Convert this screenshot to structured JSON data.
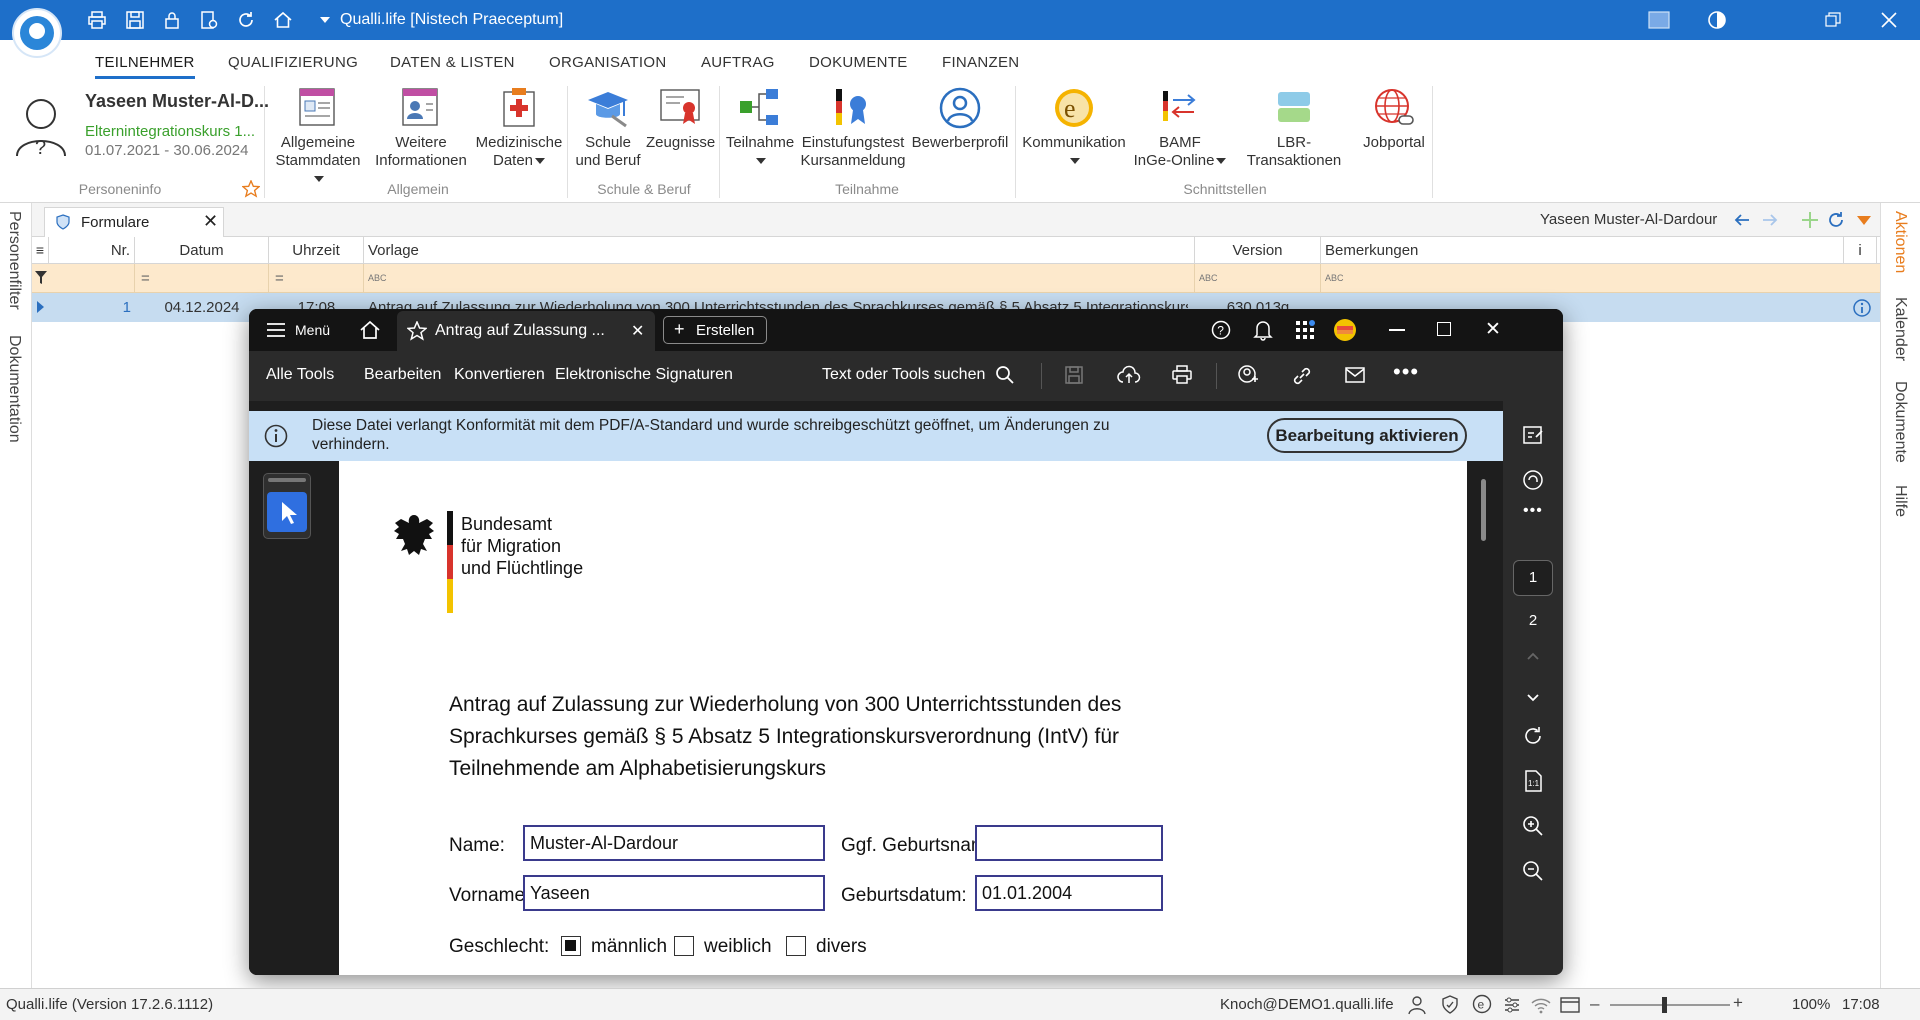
{
  "app": {
    "title": "Qualli.life [Nistech Praeceptum]",
    "status_version": "Qualli.life (Version 17.2.6.1112)",
    "status_user": "Knoch@DEMO1.qualli.life",
    "status_zoom": "100%",
    "status_time": "17:08"
  },
  "ribbon": {
    "tabs": [
      "TEILNEHMER",
      "QUALIFIZIERUNG",
      "DATEN & LISTEN",
      "ORGANISATION",
      "AUFTRAG",
      "DOKUMENTE",
      "FINANZEN"
    ],
    "person": {
      "name": "Yaseen Muster-Al-D...",
      "course": "Elternintegrationskurs 1...",
      "dates": "01.07.2021 - 30.06.2024"
    },
    "groups": {
      "personeninfo": "Personeninfo",
      "allgemein": "Allgemein",
      "schule": "Schule & Beruf",
      "teilnahme": "Teilnahme",
      "schnittstellen": "Schnittstellen"
    },
    "buttons": {
      "allgemeine_1": "Allgemeine",
      "allgemeine_2": "Stammdaten",
      "weitere_1": "Weitere",
      "weitere_2": "Informationen",
      "medizin_1": "Medizinische",
      "medizin_2": "Daten",
      "schule_1": "Schule",
      "schule_2": "und Beruf",
      "zeugnisse": "Zeugnisse",
      "teilnahme": "Teilnahme",
      "einstufung_1": "Einstufungstest",
      "einstufung_2": "Kursanmeldung",
      "bewerber": "Bewerberprofil",
      "kommunikation": "Kommunikation",
      "bamf_1": "BAMF",
      "bamf_2": "InGe-Online",
      "lbr": "LBR-Transaktionen",
      "jobportal": "Jobportal"
    }
  },
  "side": {
    "left": [
      "Personenfilter",
      "Dokumentation"
    ],
    "right_active": "Aktionen",
    "right": [
      "Kalender",
      "Dokumente",
      "Hilfe"
    ]
  },
  "doc_tab": {
    "label": "Formulare",
    "person": "Yaseen Muster-Al-Dardour"
  },
  "grid": {
    "columns": [
      "Nr.",
      "Datum",
      "Uhrzeit",
      "Vorlage",
      "Version",
      "Bemerkungen",
      "i"
    ],
    "filter_eq": "=",
    "filter_abc": "ABC",
    "row": {
      "nr": "1",
      "datum": "04.12.2024",
      "uhrzeit": "17:08",
      "vorlage": "Antrag auf Zulassung zur Wiederholung von 300 Unterrichtsstunden des Sprachkurses gemäß § 5 Absatz 5 Integrationskurs",
      "version": "630.013g"
    }
  },
  "pdf": {
    "menu_label": "Menü",
    "tab_title": "Antrag auf Zulassung ...",
    "create_label": "Erstellen",
    "tools": [
      "Alle Tools",
      "Bearbeiten",
      "Konvertieren",
      "Elektronische Signaturen"
    ],
    "search_label": "Text oder Tools suchen",
    "info_line1": "Diese Datei verlangt Konformität mit dem PDF/A-Standard und wurde schreibgeschützt geöffnet, um Änderungen zu",
    "info_line2": "verhindern.",
    "info_button": "Bearbeitung aktivieren",
    "page_numbers": [
      "1",
      "2"
    ],
    "document": {
      "agency_1": "Bundesamt",
      "agency_2": "für Migration",
      "agency_3": "und Flüchtlinge",
      "heading_1": "Antrag auf Zulassung zur Wiederholung von 300 Unterrichtsstunden des",
      "heading_2": "Sprachkurses gemäß § 5 Absatz 5 Integrationskursverordnung (IntV) für",
      "heading_3": "Teilnehmende am Alphabetisierungskurs",
      "name_label": "Name:",
      "name_value": "Muster-Al-Dardour",
      "birthname_label": "Ggf. Geburtsname:",
      "birthname_value": "",
      "vorname_label": "Vorname:",
      "vorname_value": "Yaseen",
      "birthdate_label": "Geburtsdatum:",
      "birthdate_value": "01.01.2004",
      "gender_label": "Geschlecht:",
      "gender_options": [
        "männlich",
        "weiblich",
        "divers"
      ],
      "gender_selected": "männlich"
    }
  },
  "colors": {
    "brand_blue": "#1e6fc9",
    "accent_orange": "#e87d1e",
    "course_green": "#3aa02c",
    "filter_row": "#fde9cc",
    "selected_row": "#c6dcf0"
  }
}
